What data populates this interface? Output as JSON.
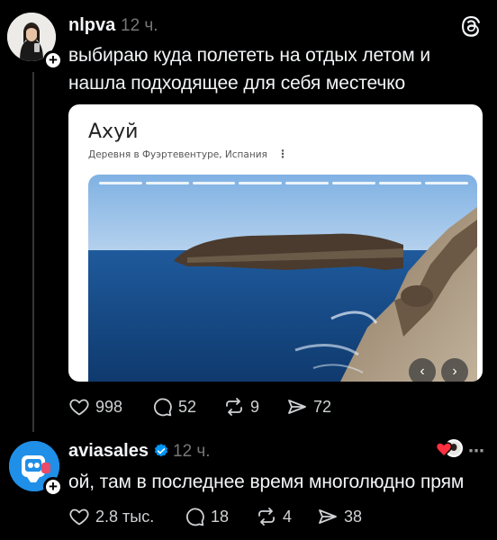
{
  "post": {
    "username": "nlpva",
    "time": "12 ч.",
    "text_line1": "выбираю куда полететь на отдых летом и",
    "text_line2": "нашла подходящее для себя местечко",
    "card": {
      "title": "Ахуй",
      "subtitle": "Деревня в Фуэртевентуре, Испания",
      "menu": "⋮",
      "prev": "‹",
      "next": "›"
    },
    "likes": "998",
    "comments": "52",
    "reposts": "9",
    "shares": "72"
  },
  "reply": {
    "username": "aviasales",
    "time": "12 ч.",
    "text": "ой, там в последнее время многолюдно прям",
    "likes": "2.8 тыс.",
    "comments": "18",
    "reposts": "4",
    "shares": "38"
  },
  "icons": {
    "threads_logo": "threads-logo-icon",
    "like": "heart-icon",
    "comment": "comment-icon",
    "repost": "repost-icon",
    "share": "share-icon"
  },
  "colors": {
    "background": "#000000",
    "text": "#f3f5f7",
    "muted": "#777777",
    "verified": "#0095f6"
  }
}
